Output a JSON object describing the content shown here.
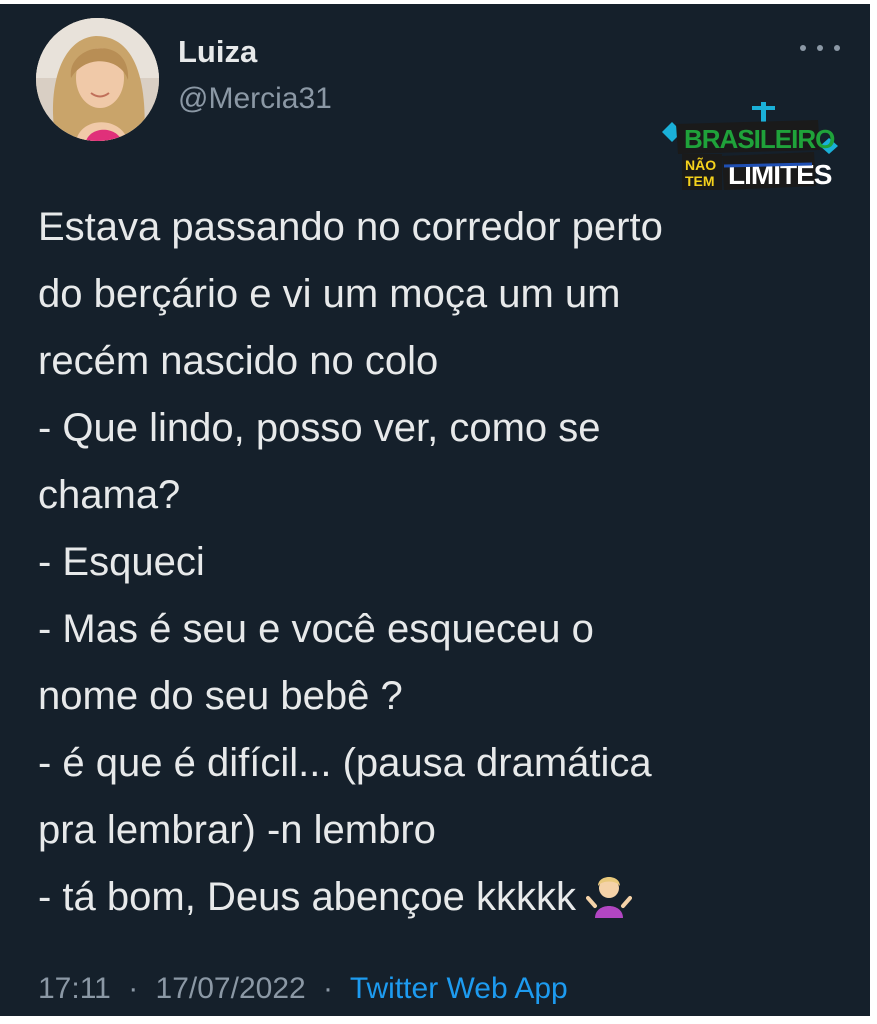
{
  "tweet": {
    "author": {
      "display_name": "Luiza",
      "handle": "@Mercia31"
    },
    "more_icon": "ellipsis-icon",
    "watermark": {
      "lines": [
        "BRASILEIRO",
        "NÃO",
        "TEM",
        "LIMITES"
      ],
      "colors": {
        "green": "#1fa23a",
        "yellow": "#f6d21c",
        "blue": "#1f4fb3",
        "cyan": "#1ab0d8"
      }
    },
    "text": "Estava passando no corredor perto\ndo berçário e vi um moça um um\nrecém nascido no colo\n- Que lindo, posso ver, como se\nchama?\n- Esqueci\n- Mas é seu e você esqueceu o\nnome do seu bebê ?\n- é que é difícil... (pausa dramática\npra lembrar) -n lembro\n- tá bom, Deus abençoe kkkkk",
    "emoji": "person-shrugging-emoji",
    "time": "17:11",
    "separator": "·",
    "date": "17/07/2022",
    "source": "Twitter Web App"
  },
  "colors": {
    "background": "#15202b",
    "text": "#e7e9ea",
    "muted": "#8b98a5",
    "link": "#1d9bf0"
  }
}
